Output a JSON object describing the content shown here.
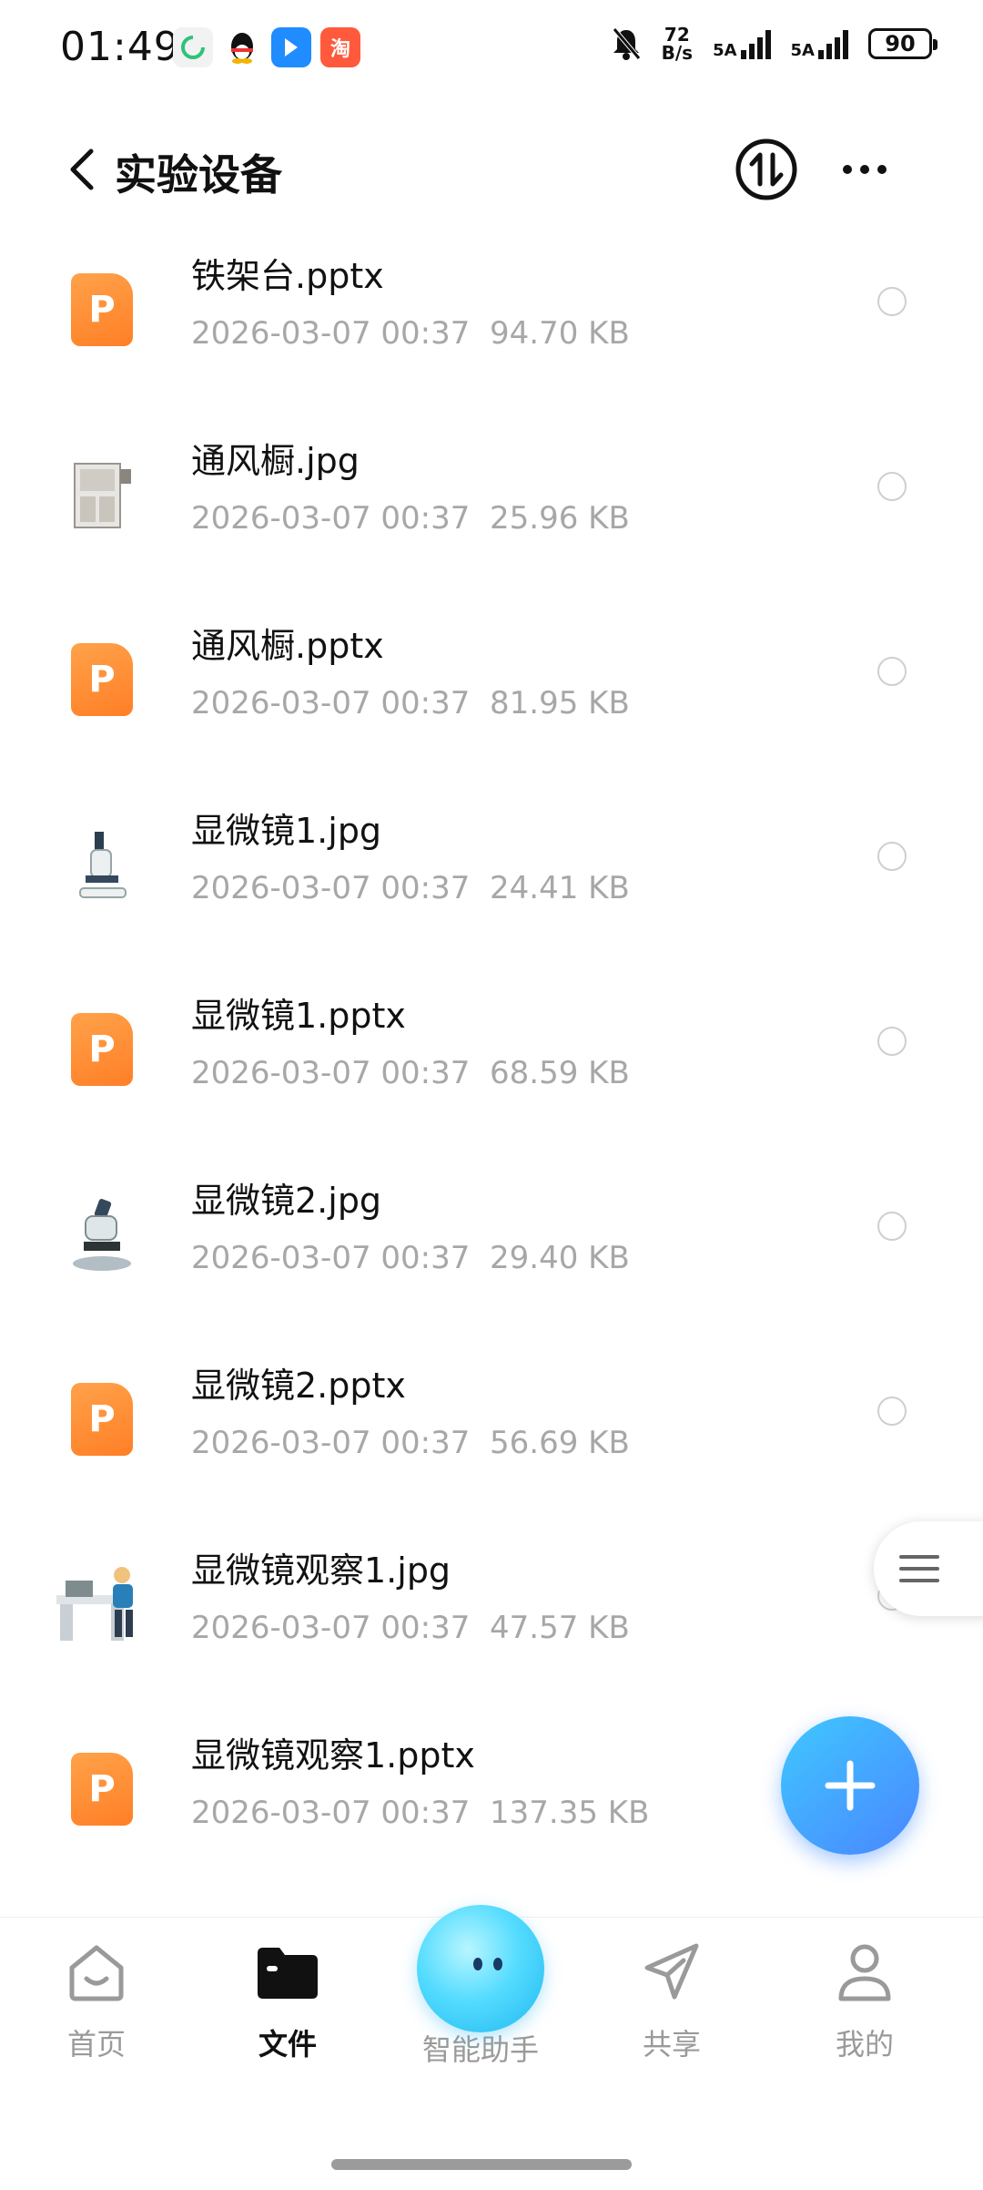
{
  "status_bar": {
    "time": "01:49",
    "net_speed_value": "72",
    "net_speed_unit": "B/s",
    "sim1": "5A",
    "sim2": "5A",
    "battery": "90",
    "app_icons": [
      "refresh-icon",
      "qq-icon",
      "blue-app-icon",
      "taobao-icon"
    ],
    "taobao_label": "淘"
  },
  "header": {
    "title": "实验设备",
    "sort_icon": "sort-icon",
    "more_icon": "more-icon"
  },
  "files": [
    {
      "name": "铁架台.pptx",
      "date": "2026-03-07 00:37",
      "size": "94.70 KB",
      "type": "pptx"
    },
    {
      "name": "通风橱.jpg",
      "date": "2026-03-07 00:37",
      "size": "25.96 KB",
      "type": "jpg"
    },
    {
      "name": "通风橱.pptx",
      "date": "2026-03-07 00:37",
      "size": "81.95 KB",
      "type": "pptx"
    },
    {
      "name": "显微镜1.jpg",
      "date": "2026-03-07 00:37",
      "size": "24.41 KB",
      "type": "jpg"
    },
    {
      "name": "显微镜1.pptx",
      "date": "2026-03-07 00:37",
      "size": "68.59 KB",
      "type": "pptx"
    },
    {
      "name": "显微镜2.jpg",
      "date": "2026-03-07 00:37",
      "size": "29.40 KB",
      "type": "jpg"
    },
    {
      "name": "显微镜2.pptx",
      "date": "2026-03-07 00:37",
      "size": "56.69 KB",
      "type": "pptx"
    },
    {
      "name": "显微镜观察1.jpg",
      "date": "2026-03-07 00:37",
      "size": "47.57 KB",
      "type": "jpg"
    },
    {
      "name": "显微镜观察1.pptx",
      "date": "2026-03-07 00:37",
      "size": "137.35 KB",
      "type": "pptx"
    }
  ],
  "ppt_letter": "P",
  "bottom_nav": {
    "items": [
      {
        "label": "首页",
        "icon": "home-icon",
        "active": false
      },
      {
        "label": "文件",
        "icon": "folder-icon",
        "active": true
      },
      {
        "label": "智能助手",
        "icon": "assistant-orb-icon",
        "active": false
      },
      {
        "label": "共享",
        "icon": "share-icon",
        "active": false
      },
      {
        "label": "我的",
        "icon": "profile-icon",
        "active": false
      }
    ]
  },
  "colors": {
    "accent": "#4a86ff",
    "ppt_orange": "#ff8a33",
    "meta_gray": "#a7a7a7"
  }
}
